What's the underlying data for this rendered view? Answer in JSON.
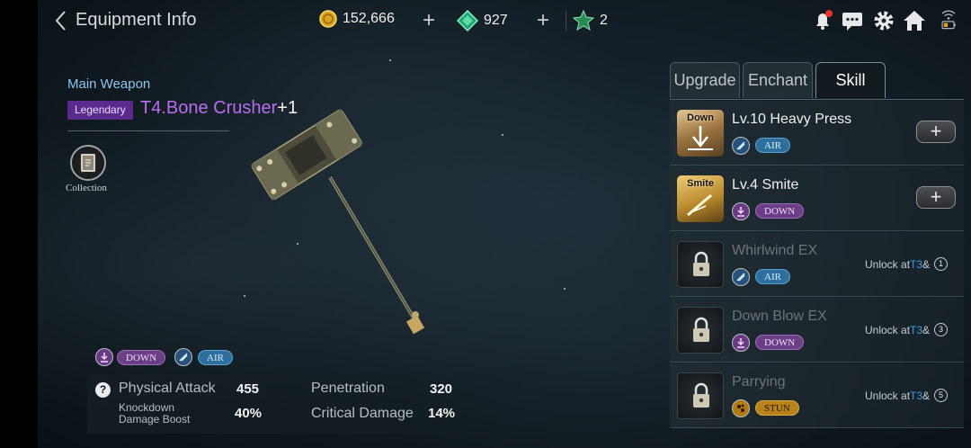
{
  "header": {
    "title": "Equipment Info",
    "gold": "152,666",
    "gems": "927",
    "tokens": "2"
  },
  "weapon": {
    "slot_label": "Main Weapon",
    "rarity": "Legendary",
    "name": "T4.Bone Crusher",
    "enhance": "+1",
    "collection_label": "Collection",
    "tags": [
      "DOWN",
      "AIR"
    ]
  },
  "stats": {
    "physical_attack_label": "Physical Attack",
    "physical_attack_value": "455",
    "knockdown_label_1": "Knockdown",
    "knockdown_label_2": "Damage Boost",
    "knockdown_value": "40%",
    "penetration_label": "Penetration",
    "penetration_value": "320",
    "critical_damage_label": "Critical Damage",
    "critical_damage_value": "14%"
  },
  "tabs": [
    "Upgrade",
    "Enchant",
    "Skill"
  ],
  "active_tab": "Skill",
  "skills": [
    {
      "name": "Lv.10 Heavy Press",
      "icon_label": "Down",
      "tag": "AIR",
      "locked": false
    },
    {
      "name": "Lv.4 Smite",
      "icon_label": "Smite",
      "tag": "DOWN",
      "locked": false
    },
    {
      "name": "Whirlwind EX",
      "tag": "AIR",
      "locked": true,
      "unlock_prefix": "Unlock at ",
      "unlock_tier": "T3",
      "unlock_suffix": " &",
      "unlock_level": "1"
    },
    {
      "name": "Down Blow EX",
      "tag": "DOWN",
      "locked": true,
      "unlock_prefix": "Unlock at ",
      "unlock_tier": "T3",
      "unlock_suffix": " &",
      "unlock_level": "3"
    },
    {
      "name": "Parrying",
      "tag": "STUN",
      "locked": true,
      "unlock_prefix": "Unlock at ",
      "unlock_tier": "T3",
      "unlock_suffix": " &",
      "unlock_level": "5"
    }
  ],
  "colors": {
    "legendary": "#5a2b8c",
    "weapon_name": "#b66df0",
    "tier_highlight": "#3a9ee8",
    "down_tag": "#6b3f86",
    "air_tag": "#2f6f9e",
    "stun_tag": "#b7821c"
  }
}
